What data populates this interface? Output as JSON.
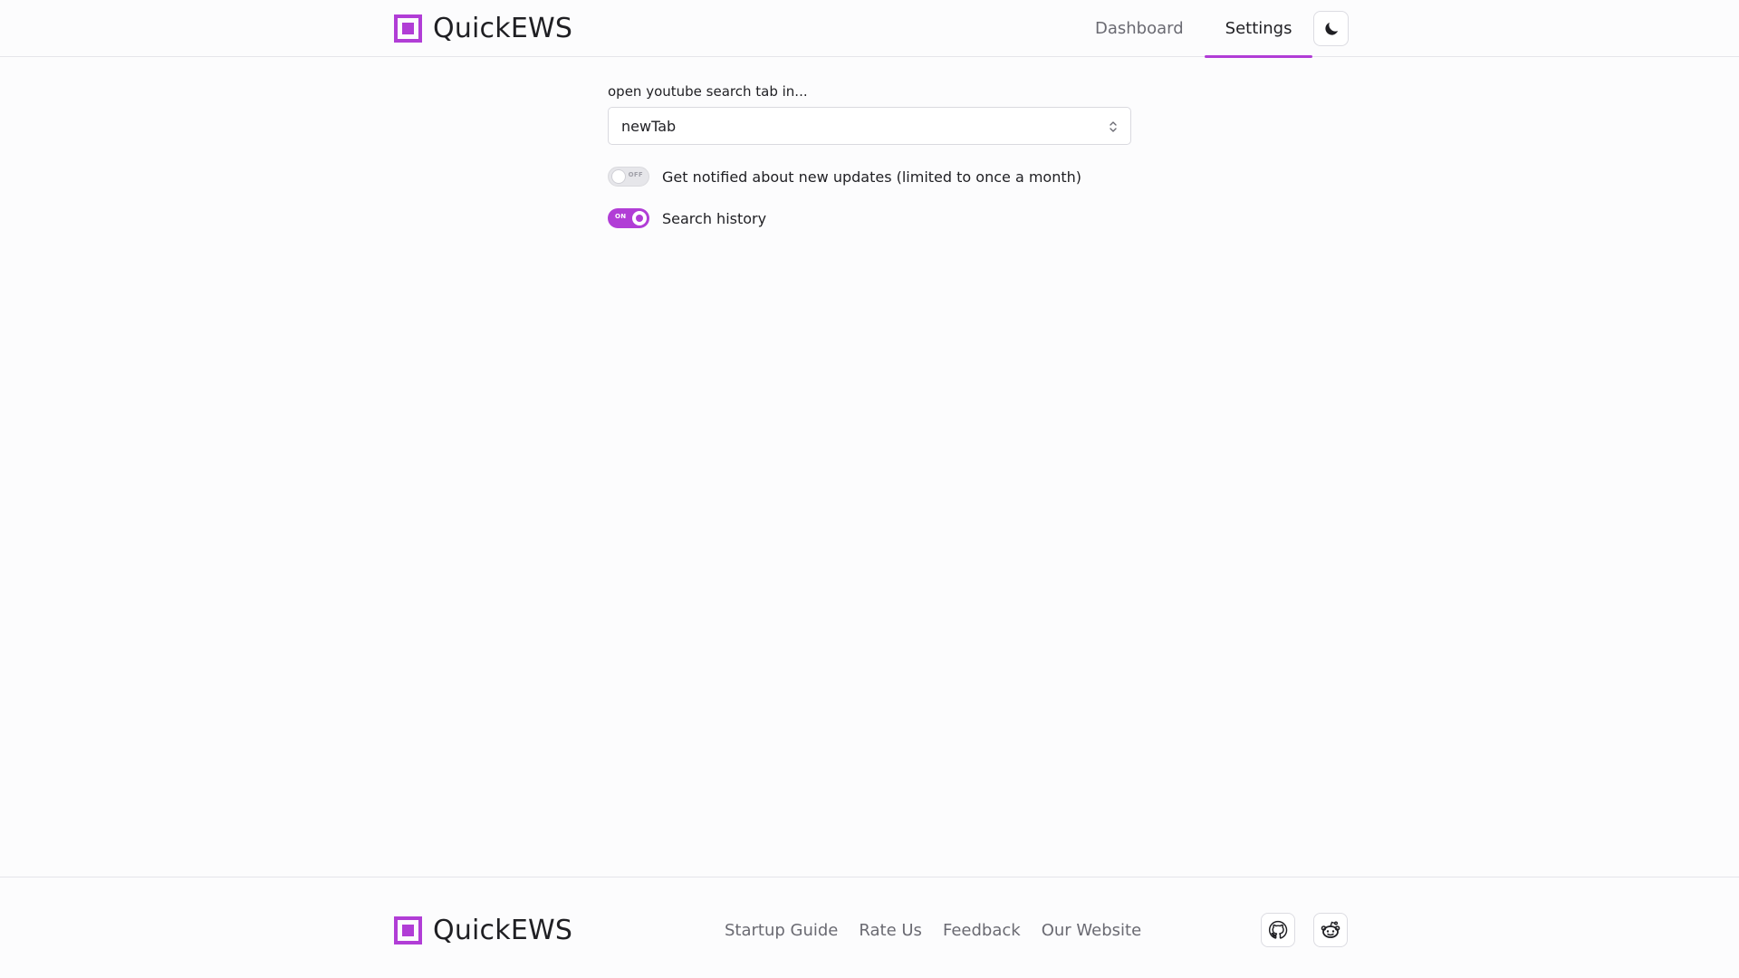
{
  "app": {
    "name": "QuickEWS"
  },
  "header": {
    "nav": [
      {
        "label": "Dashboard",
        "active": false
      },
      {
        "label": "Settings",
        "active": true
      }
    ],
    "theme_toggle_icon": "moon-icon"
  },
  "settings": {
    "open_tab_label": "open youtube search tab in...",
    "open_tab_value": "newTab",
    "notify": {
      "label": "Get notified about new updates (limited to once a month)",
      "state": "OFF",
      "enabled": false
    },
    "history": {
      "label": "Search history",
      "state": "ON",
      "enabled": true
    }
  },
  "footer": {
    "links": [
      "Startup Guide",
      "Rate Us",
      "Feedback",
      "Our Website"
    ],
    "social_icons": [
      "github-icon",
      "reddit-icon"
    ]
  },
  "colors": {
    "accent": "#b13dd6",
    "background": "#fcfcfd",
    "border": "#e5e5ea"
  }
}
